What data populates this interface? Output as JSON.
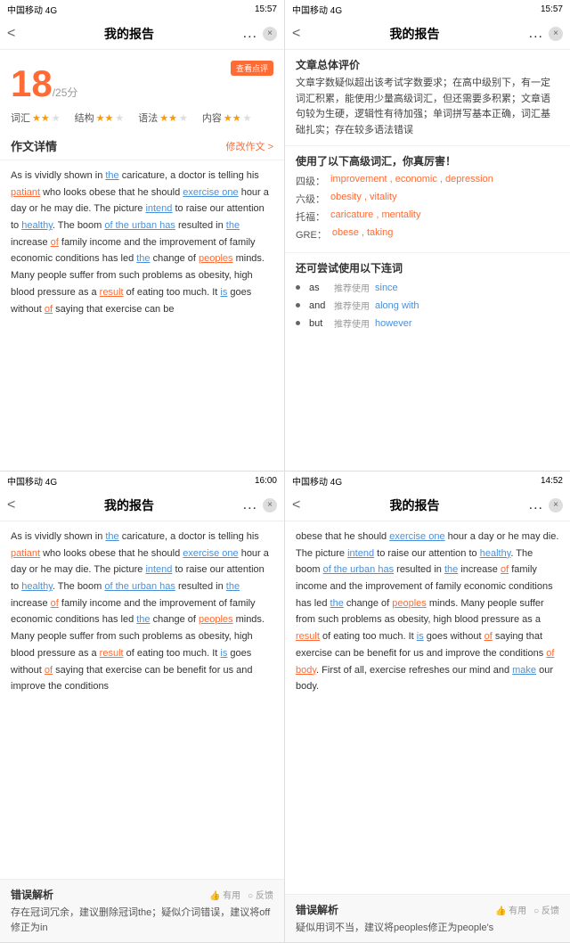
{
  "panel1": {
    "status": {
      "carrier": "中国移动 4G",
      "time": "15:57"
    },
    "nav": {
      "title": "我的报告",
      "back": "<",
      "dots": "...",
      "close": "×"
    },
    "score": {
      "number": "18",
      "total": "/25分",
      "badge": "查看点评"
    },
    "metrics": [
      {
        "label": "词汇",
        "stars": 2,
        "total": 3
      },
      {
        "label": "结构",
        "stars": 2,
        "total": 3
      },
      {
        "label": "语法",
        "stars": 2,
        "total": 3
      },
      {
        "label": "内容",
        "stars": 2,
        "total": 3
      }
    ],
    "section": {
      "title": "作文详情",
      "action": "修改作文 >"
    },
    "essay": "As is vividly shown in the caricature, a doctor is telling his patiant who looks obese that he should exercise one hour a day or he may die. The picture intend to raise our attention to healthy. The boom of the urban has resulted in the increase of family income and the improvement of family economic conditions has led the change of peoples minds. Many people suffer from such problems as obesity, high blood pressure as a result of eating too much. It is goes without of saying that exercise can be"
  },
  "panel2": {
    "status": {
      "carrier": "中国移动 4G",
      "time": "15:57"
    },
    "nav": {
      "title": "我的报告",
      "back": "<",
      "dots": "...",
      "close": "×"
    },
    "overall": {
      "title": "文章总体评价",
      "text": "文章字数疑似超出该考试字数要求；在高中级别下，有一定词汇积累，能使用少量高级词汇，但还需要多积累；文章语句较为生硬，逻辑性有待加强；单词拼写基本正确，词汇基础扎实；存在较多语法错误"
    },
    "vocab": {
      "title": "使用了以下高级词汇，你真厉害！",
      "items": [
        {
          "level": "四级：",
          "words": "improvement , economic , depression"
        },
        {
          "level": "六级：",
          "words": "obesity , vitality"
        },
        {
          "level": "托福：",
          "words": "caricature , mentality"
        },
        {
          "level": "GRE：",
          "words": "obese , taking"
        }
      ]
    },
    "connectors": {
      "title": "还可尝试使用以下连词",
      "items": [
        {
          "word": "as",
          "label": "推荐使用",
          "suggest": "since"
        },
        {
          "word": "and",
          "label": "推荐使用",
          "suggest": "along with"
        },
        {
          "word": "but",
          "label": "推荐使用",
          "suggest": "however"
        }
      ]
    }
  },
  "panel3": {
    "status": {
      "carrier": "中国移动 4G",
      "time": "16:00"
    },
    "nav": {
      "title": "我的报告",
      "back": "<",
      "dots": "...",
      "close": "×"
    },
    "essay": "As is vividly shown in the caricature, a doctor is telling his patiant who looks obese that he should exercise one hour a day or he may die. The picture intend to raise our attention to healthy. The boom of the urban has resulted in the increase of family income and the improvement of family economic conditions has led the change of peoples minds. Many people suffer from such problems as obesity, high blood pressure as a result of eating too much. It is goes without of saying that exercise can be benefit for us and improve the conditions",
    "error": {
      "title": "错误解析",
      "actions": [
        "👍 有用",
        "○ 反馈"
      ],
      "text": "存在冠词冗余，建议删除冠词the；疑似介词错误，建议将off修正为in"
    }
  },
  "panel4": {
    "status": {
      "carrier": "中国移动 4G",
      "time": "14:52"
    },
    "nav": {
      "title": "我的报告",
      "back": "<",
      "dots": "...",
      "close": "×"
    },
    "essay": "obese that he should exercise one hour a day or he may die. The picture intend to raise our attention to healthy. The boom of the urban has resulted in the increase of family income and the improvement of family economic conditions has led the change of peoples minds. Many people suffer from such problems as obesity, high blood pressure as a result of eating too much. It is goes without of saying that exercise can be benefit for us and improve the conditions of body. First of all, exercise refreshes our mind and make our body.",
    "error": {
      "title": "错误解析",
      "actions": [
        "👍 有用",
        "○ 反馈"
      ],
      "text": "疑似用词不当，建议将peoples修正为people's"
    }
  }
}
